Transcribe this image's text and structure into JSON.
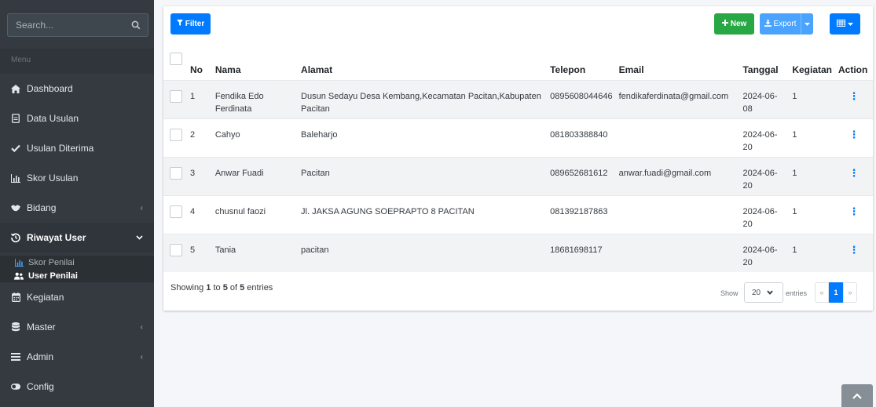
{
  "sidebar": {
    "search_placeholder": "Search...",
    "menu_header": "Menu",
    "items": [
      {
        "label": "Dashboard",
        "icon": "home-icon"
      },
      {
        "label": "Data Usulan",
        "icon": "file-icon"
      },
      {
        "label": "Usulan Diterima",
        "icon": "check-icon"
      },
      {
        "label": "Skor Usulan",
        "icon": "bar-chart-icon"
      },
      {
        "label": "Bidang",
        "icon": "handshake-icon"
      },
      {
        "label": "Riwayat User",
        "icon": "history-icon"
      },
      {
        "label": "Kegiatan",
        "icon": "calendar-icon"
      },
      {
        "label": "Master",
        "icon": "database-icon"
      },
      {
        "label": "Admin",
        "icon": "list-icon"
      },
      {
        "label": "Config",
        "icon": "toggle-icon"
      }
    ],
    "submenu": [
      {
        "label": "Skor Penilai",
        "icon": "bar-chart-icon"
      },
      {
        "label": "User Penilai",
        "icon": "users-icon"
      }
    ]
  },
  "toolbar": {
    "filter_label": "Filter",
    "new_label": "New",
    "export_label": "Export"
  },
  "table": {
    "headers": [
      "No",
      "Nama",
      "Alamat",
      "Telepon",
      "Email",
      "Tanggal",
      "Kegiatan",
      "Action"
    ],
    "rows": [
      {
        "no": "1",
        "nama": "Fendika Edo Ferdinata",
        "alamat": "Dusun Sedayu Desa Kembang,Kecamatan Pacitan,Kabupaten Pacitan",
        "telepon": "0895608044646",
        "email": "fendikaferdinata@gmail.com",
        "tanggal": "2024-06-08",
        "kegiatan": "1"
      },
      {
        "no": "2",
        "nama": "Cahyo",
        "alamat": "Baleharjo",
        "telepon": "081803388840",
        "email": "",
        "tanggal": "2024-06-20",
        "kegiatan": "1"
      },
      {
        "no": "3",
        "nama": "Anwar Fuadi",
        "alamat": "Pacitan",
        "telepon": "089652681612",
        "email": "anwar.fuadi@gmail.com",
        "tanggal": "2024-06-20",
        "kegiatan": "1"
      },
      {
        "no": "4",
        "nama": "chusnul faozi",
        "alamat": "Jl. JAKSA AGUNG SOEPRAPTO 8 PACITAN",
        "telepon": "081392187863",
        "email": "",
        "tanggal": "2024-06-20",
        "kegiatan": "1"
      },
      {
        "no": "5",
        "nama": "Tania",
        "alamat": "pacitan",
        "telepon": "18681698117",
        "email": "",
        "tanggal": "2024-06-20",
        "kegiatan": "1"
      }
    ]
  },
  "footer": {
    "showing_prefix": "Showing ",
    "from": "1",
    "to_word": " to ",
    "to": "5",
    "of_word": " of ",
    "total": "5",
    "entries_word": " entries",
    "show_label": "Show",
    "page_size": "20",
    "entries_label": "entries",
    "pager_prev": "«",
    "pager_current": "1",
    "pager_next": "»"
  },
  "colors": {
    "sidebar_bg": "#343a40",
    "primary": "#007bff",
    "success": "#28a745",
    "info": "#4aa3ff"
  }
}
